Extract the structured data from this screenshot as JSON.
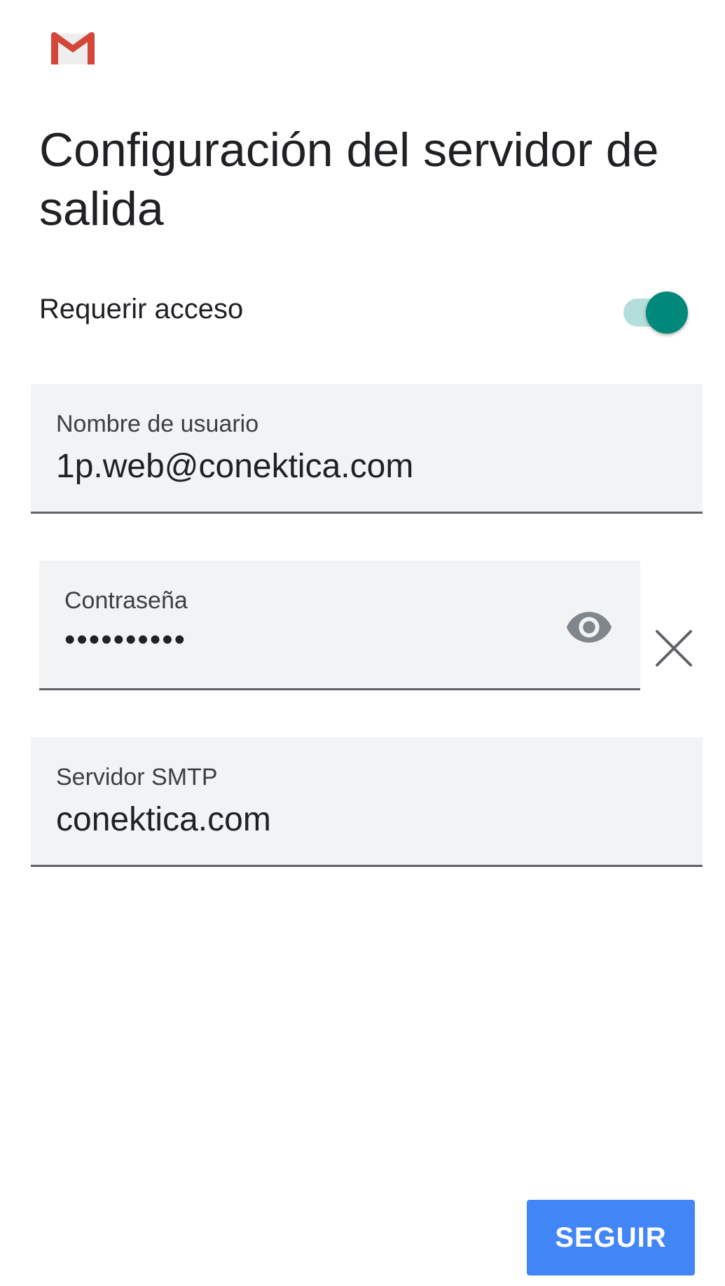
{
  "app": {
    "logo": "gmail-logo-icon"
  },
  "page": {
    "title": "Configuración del servidor de salida"
  },
  "auth_toggle": {
    "label": "Requerir acceso",
    "enabled": true,
    "accent_color": "#00897b"
  },
  "fields": {
    "username": {
      "label": "Nombre de usuario",
      "value": "1p.web@conektica.com"
    },
    "password": {
      "label": "Contraseña",
      "value": "••••••••••",
      "visibility_icon": "eye-icon",
      "clear_icon": "close-icon"
    },
    "smtp_server": {
      "label": "Servidor SMTP",
      "value": "conektica.com"
    }
  },
  "actions": {
    "next_label": "SEGUIR",
    "next_color": "#4285f4"
  }
}
